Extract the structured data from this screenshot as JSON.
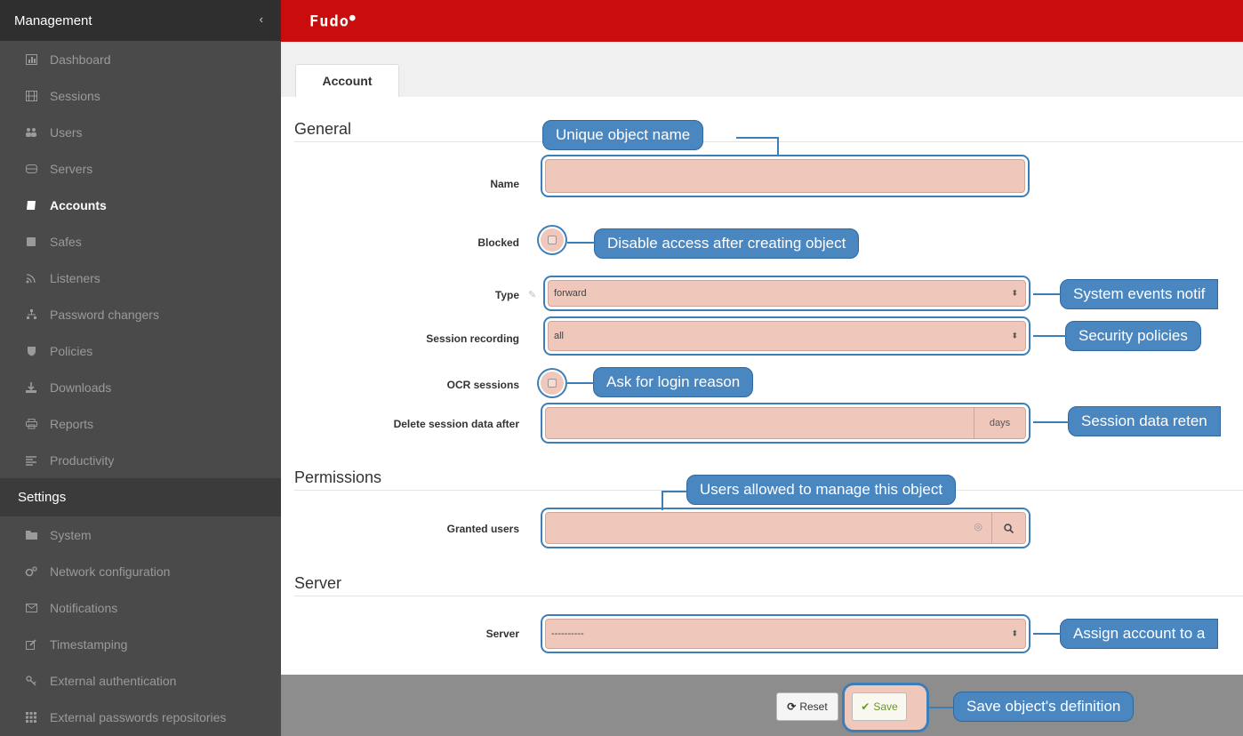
{
  "sidebar": {
    "management_label": "Management",
    "collapse_icon": "‹",
    "items": [
      {
        "label": "Dashboard",
        "icon": "chart-icon"
      },
      {
        "label": "Sessions",
        "icon": "film-icon"
      },
      {
        "label": "Users",
        "icon": "users-icon"
      },
      {
        "label": "Servers",
        "icon": "server-icon"
      },
      {
        "label": "Accounts",
        "icon": "book-icon"
      },
      {
        "label": "Safes",
        "icon": "safe-icon"
      },
      {
        "label": "Listeners",
        "icon": "rss-icon"
      },
      {
        "label": "Password changers",
        "icon": "sitemap-icon"
      },
      {
        "label": "Policies",
        "icon": "shield-icon"
      },
      {
        "label": "Downloads",
        "icon": "download-icon"
      },
      {
        "label": "Reports",
        "icon": "print-icon"
      },
      {
        "label": "Productivity",
        "icon": "list-icon"
      }
    ],
    "settings_label": "Settings",
    "settings_items": [
      {
        "label": "System",
        "icon": "folder-icon"
      },
      {
        "label": "Network configuration",
        "icon": "gears-icon"
      },
      {
        "label": "Notifications",
        "icon": "envelope-icon"
      },
      {
        "label": "Timestamping",
        "icon": "edit-icon"
      },
      {
        "label": "External authentication",
        "icon": "key-icon"
      },
      {
        "label": "External passwords repositories",
        "icon": "grid-icon"
      }
    ]
  },
  "topbar": {
    "logo": "Fudo"
  },
  "tabs": [
    {
      "label": "Account"
    }
  ],
  "form": {
    "general_title": "General",
    "name_label": "Name",
    "blocked_label": "Blocked",
    "type_label": "Type",
    "type_value": "forward",
    "session_recording_label": "Session recording",
    "session_recording_value": "all",
    "ocr_label": "OCR sessions",
    "delete_after_label": "Delete session data after",
    "delete_after_unit": "days",
    "permissions_title": "Permissions",
    "granted_users_label": "Granted users",
    "server_title": "Server",
    "server_label": "Server",
    "server_value": "----------"
  },
  "callouts": {
    "name": "Unique object name",
    "blocked": "Disable access after creating object",
    "type": "System events notif",
    "session_recording": "Security policies",
    "ocr": "Ask for login reason",
    "delete_after": "Session data reten",
    "granted_users": "Users allowed to manage this object",
    "server": "Assign account to a",
    "save": "Save object's definition"
  },
  "footer": {
    "reset_label": "Reset",
    "save_label": "Save"
  },
  "colors": {
    "brand_red": "#c90d0d",
    "callout_blue": "#4a86c0",
    "highlight": "#efc7bb"
  }
}
